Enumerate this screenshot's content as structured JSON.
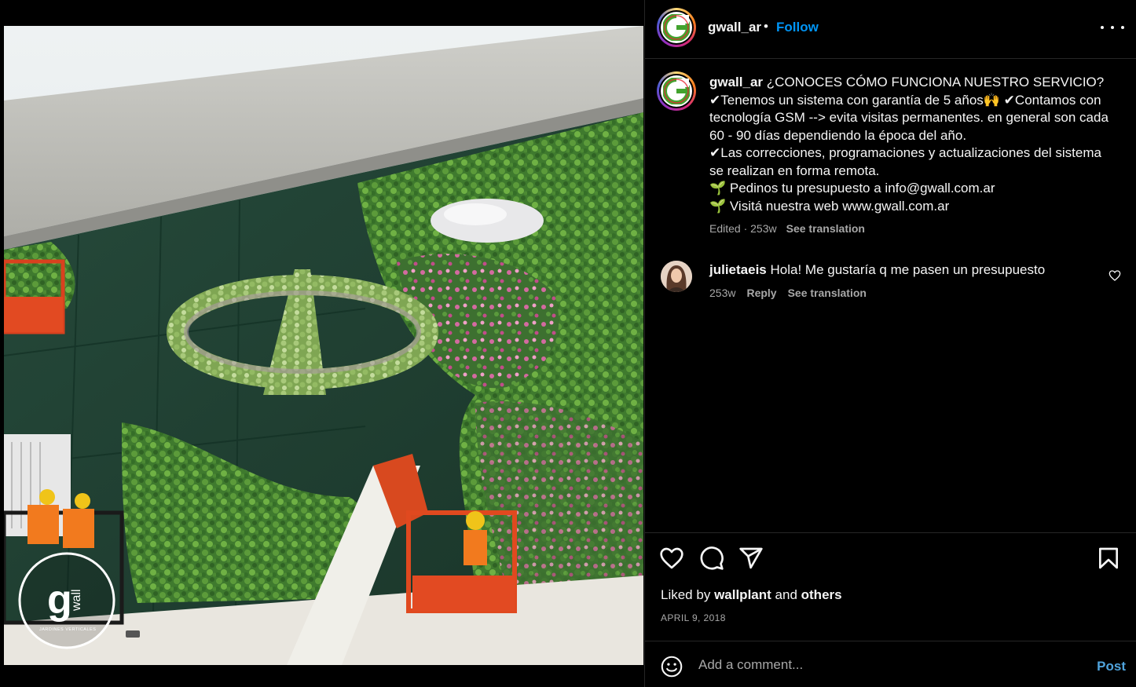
{
  "post": {
    "username": "gwall_ar",
    "follow_label": "Follow",
    "dot": "•",
    "caption_text": "¿CONOCES CÓMO FUNCIONA NUESTRO SERVICIO?\n✔Tenemos un sistema con garantía de 5 años🙌 ✔Contamos con tecnología GSM --> evita visitas permanentes. en general son cada 60 - 90 días dependiendo la época del año.\n✔Las correcciones, programaciones y actualizaciones del sistema se realizan en forma remota.\n🌱 Pedinos tu presupuesto a info@gwall.com.ar\n🌱 Visitá nuestra web www.gwall.com.ar",
    "edited": "Edited · 253w",
    "see_translation": "See translation",
    "image_logo_text": "g",
    "image_logo_sub": "wall",
    "image_logo_caption": "JARDINES VERTICALES"
  },
  "comment": {
    "username": "julietaeis",
    "text": "Hola! Me gustaría q me pasen un presupuesto",
    "time": "253w",
    "reply": "Reply",
    "see_translation": "See translation"
  },
  "likes": {
    "prefix": "Liked by",
    "user": "wallplant",
    "conj": "and",
    "others": "others"
  },
  "date": "APRIL 9, 2018",
  "add_comment": {
    "placeholder": "Add a comment...",
    "post_label": "Post"
  },
  "icons": [
    "more-icon",
    "heart-icon",
    "comment-icon",
    "share-icon",
    "bookmark-icon",
    "emoji-icon"
  ],
  "colors": {
    "accent": "#0095f6",
    "background": "#000000",
    "muted": "#a8a8a8"
  }
}
